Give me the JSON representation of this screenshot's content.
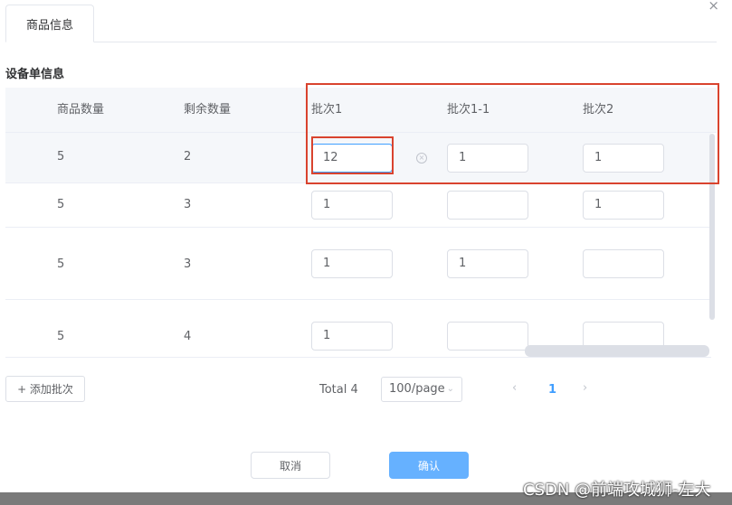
{
  "dialog": {
    "close_icon": "×"
  },
  "tabs": [
    {
      "label": "商品信息"
    }
  ],
  "section_title": "设备单信息",
  "table": {
    "headers": [
      "商品数量",
      "剩余数量",
      "批次1",
      "批次1-1",
      "批次2"
    ],
    "rows": [
      {
        "qty": "5",
        "remaining": "2",
        "batch1": "12",
        "batch1_1": "1",
        "batch2": "1"
      },
      {
        "qty": "5",
        "remaining": "3",
        "batch1": "1",
        "batch1_1": "",
        "batch2": "1"
      },
      {
        "qty": "5",
        "remaining": "3",
        "batch1": "1",
        "batch1_1": "1",
        "batch2": ""
      },
      {
        "qty": "5",
        "remaining": "4",
        "batch1": "1",
        "batch1_1": "",
        "batch2": ""
      }
    ]
  },
  "clear_icon": "×",
  "add_batch_label": "+ 添加批次",
  "pagination": {
    "total": "Total 4",
    "page_size": "100/page",
    "page_size_chevron": "⌄",
    "prev": "‹",
    "current": "1",
    "next": "›"
  },
  "footer": {
    "cancel": "取消",
    "confirm": "确认"
  },
  "watermark": "CSDN @前端攻城狮-左大",
  "colors": {
    "accent": "#409eff",
    "highlight_box": "#d9432e",
    "confirm_bg": "#66b1ff"
  }
}
